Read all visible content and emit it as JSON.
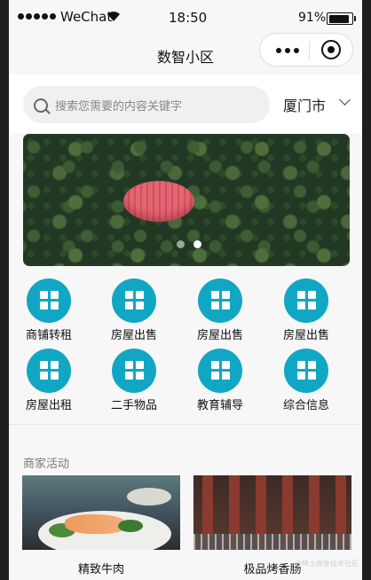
{
  "status_bar": {
    "carrier": "WeChat",
    "time": "18:50",
    "battery_percent": "91%",
    "battery_level": 0.91
  },
  "nav": {
    "title": "数智小区"
  },
  "search": {
    "placeholder": "搜索您需要的内容关键字",
    "city": "厦门市"
  },
  "banner": {
    "slide_count": 2,
    "active_slide": 2
  },
  "grid": {
    "items": [
      {
        "label": "商铺转租",
        "icon": "grid-icon"
      },
      {
        "label": "房屋出售",
        "icon": "grid-icon"
      },
      {
        "label": "房屋出售",
        "icon": "grid-icon"
      },
      {
        "label": "房屋出售",
        "icon": "grid-icon"
      },
      {
        "label": "房屋出租",
        "icon": "grid-icon"
      },
      {
        "label": "二手物品",
        "icon": "grid-icon"
      },
      {
        "label": "教育辅导",
        "icon": "grid-icon"
      },
      {
        "label": "综合信息",
        "icon": "grid-icon"
      }
    ],
    "icon_color": "#11a7c4"
  },
  "merchant": {
    "title": "商家活动",
    "cards": [
      {
        "label": "精致牛肉",
        "image": "salmon-dish-image"
      },
      {
        "label": "极品烤香肠",
        "image": "grilled-sausage-image"
      }
    ]
  },
  "watermark": "@稀土掘金技术社区"
}
